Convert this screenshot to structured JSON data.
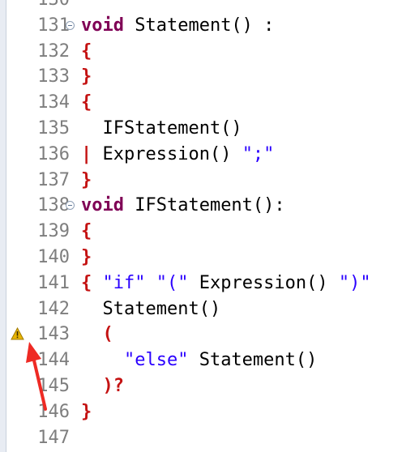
{
  "editor": {
    "lines": [
      {
        "num": "130",
        "tokens": []
      },
      {
        "num": "131",
        "fold": true,
        "tokens": [
          {
            "t": "void",
            "c": "kw"
          },
          {
            "t": " Statement() :",
            "c": "id"
          }
        ]
      },
      {
        "num": "132",
        "tokens": [
          {
            "t": "{",
            "c": "pun"
          }
        ]
      },
      {
        "num": "133",
        "tokens": [
          {
            "t": "}",
            "c": "pun"
          }
        ]
      },
      {
        "num": "134",
        "tokens": [
          {
            "t": "{",
            "c": "pun"
          }
        ]
      },
      {
        "num": "135",
        "tokens": [
          {
            "t": "  IFStatement()",
            "c": "id"
          }
        ]
      },
      {
        "num": "136",
        "tokens": [
          {
            "t": "|",
            "c": "pun"
          },
          {
            "t": " Expression() ",
            "c": "id"
          },
          {
            "t": "\";\"",
            "c": "str"
          }
        ]
      },
      {
        "num": "137",
        "tokens": [
          {
            "t": "}",
            "c": "pun"
          }
        ]
      },
      {
        "num": "138",
        "fold": true,
        "tokens": [
          {
            "t": "void",
            "c": "kw"
          },
          {
            "t": " IFStatement():",
            "c": "id"
          }
        ]
      },
      {
        "num": "139",
        "tokens": [
          {
            "t": "{",
            "c": "pun"
          }
        ]
      },
      {
        "num": "140",
        "tokens": [
          {
            "t": "}",
            "c": "pun"
          }
        ]
      },
      {
        "num": "141",
        "tokens": [
          {
            "t": "{",
            "c": "pun"
          },
          {
            "t": " \"if\" \"(\"",
            "c": "str"
          },
          {
            "t": " Expression() ",
            "c": "id"
          },
          {
            "t": "\")\"",
            "c": "str"
          }
        ]
      },
      {
        "num": "142",
        "tokens": [
          {
            "t": "  Statement()",
            "c": "id"
          }
        ]
      },
      {
        "num": "143",
        "warning": true,
        "tokens": [
          {
            "t": "  (",
            "c": "pun"
          }
        ]
      },
      {
        "num": "144",
        "tokens": [
          {
            "t": "    \"else\"",
            "c": "str"
          },
          {
            "t": " Statement()",
            "c": "id"
          }
        ]
      },
      {
        "num": "145",
        "tokens": [
          {
            "t": "  )?",
            "c": "pun"
          }
        ]
      },
      {
        "num": "146",
        "tokens": [
          {
            "t": "}",
            "c": "pun"
          }
        ]
      },
      {
        "num": "147",
        "tokens": []
      }
    ]
  },
  "icons": {
    "fold": "fold-collapse-icon",
    "warning": "warning-icon",
    "annotation": "red-arrow-annotation"
  },
  "colors": {
    "keyword": "#7f0055",
    "punctuation": "#c41212",
    "string": "#2a00ff",
    "line_number": "#7e7e7e",
    "warning": "#e8b400",
    "arrow": "#ee2a24"
  }
}
